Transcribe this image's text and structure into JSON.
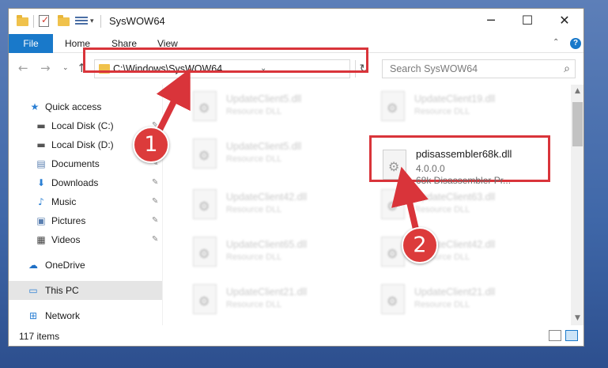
{
  "window": {
    "title": "SysWOW64",
    "minimize_label": "─",
    "maximize_label": "☐",
    "close_label": "✕"
  },
  "ribbon": {
    "file_tab": "File",
    "tabs": [
      "Home",
      "Share",
      "View"
    ],
    "collapse_icon": "chevron-up-icon",
    "help_label": "?"
  },
  "nav": {
    "back_icon": "←",
    "forward_icon": "→",
    "recent_icon": "⌄",
    "up_icon": "↑",
    "address": "C:\\Windows\\SysWOW64",
    "address_dropdown": "⌄",
    "refresh_icon": "↻",
    "search_placeholder": "Search SysWOW64",
    "search_icon": "⌕"
  },
  "sidebar": {
    "items": [
      {
        "label": "Quick access",
        "icon": "star-icon",
        "glyph": "★",
        "color": "#2a7fd4"
      },
      {
        "label": "Local Disk (C:)",
        "icon": "drive-icon",
        "glyph": "▬",
        "color": "#555555",
        "pinned": true
      },
      {
        "label": "Local Disk (D:)",
        "icon": "drive-icon",
        "glyph": "▬",
        "color": "#555555",
        "pinned": true
      },
      {
        "label": "Documents",
        "icon": "documents-icon",
        "glyph": "▤",
        "color": "#5a7fb0",
        "pinned": true
      },
      {
        "label": "Downloads",
        "icon": "downloads-icon",
        "glyph": "⬇",
        "color": "#2a7fd4",
        "pinned": true
      },
      {
        "label": "Music",
        "icon": "music-icon",
        "glyph": "♪",
        "color": "#2a7fd4",
        "pinned": true
      },
      {
        "label": "Pictures",
        "icon": "pictures-icon",
        "glyph": "▣",
        "color": "#5a7fb0",
        "pinned": true
      },
      {
        "label": "Videos",
        "icon": "videos-icon",
        "glyph": "▦",
        "color": "#444444",
        "pinned": true
      },
      {
        "label": "OneDrive",
        "icon": "onedrive-icon",
        "glyph": "☁",
        "color": "#1f6fc5"
      },
      {
        "label": "This PC",
        "icon": "computer-icon",
        "glyph": "▭",
        "color": "#2a7fd4",
        "selected": true
      },
      {
        "label": "Network",
        "icon": "network-icon",
        "glyph": "⊞",
        "color": "#2a7fd4"
      }
    ],
    "pin_glyph": "📌"
  },
  "files": [
    {
      "name": "UpdateClient5.dll",
      "type": "Resource DLL"
    },
    {
      "name": "UpdateClient19.dll",
      "type": "Resource DLL"
    },
    {
      "name": "UpdateClient5.dll",
      "type": "Resource DLL"
    },
    {
      "name": "pdisassembler68k.dll",
      "version": "4.0.0.0",
      "description": "68k Disassembler Pr...",
      "highlighted": true
    },
    {
      "name": "UpdateClient42.dll",
      "type": "Resource DLL"
    },
    {
      "name": "UpdateClient63.dll",
      "type": "Resource DLL"
    },
    {
      "name": "UpdateClient65.dll",
      "type": "Resource DLL"
    },
    {
      "name": "UpdateClient42.dll",
      "type": "Resource DLL"
    },
    {
      "name": "UpdateClient21.dll",
      "type": "Resource DLL"
    },
    {
      "name": "UpdateClient21.dll",
      "type": "Resource DLL"
    }
  ],
  "status": {
    "item_count": "117 items"
  },
  "annotations": {
    "step1": "1",
    "step2": "2",
    "color": "#d9343a"
  }
}
